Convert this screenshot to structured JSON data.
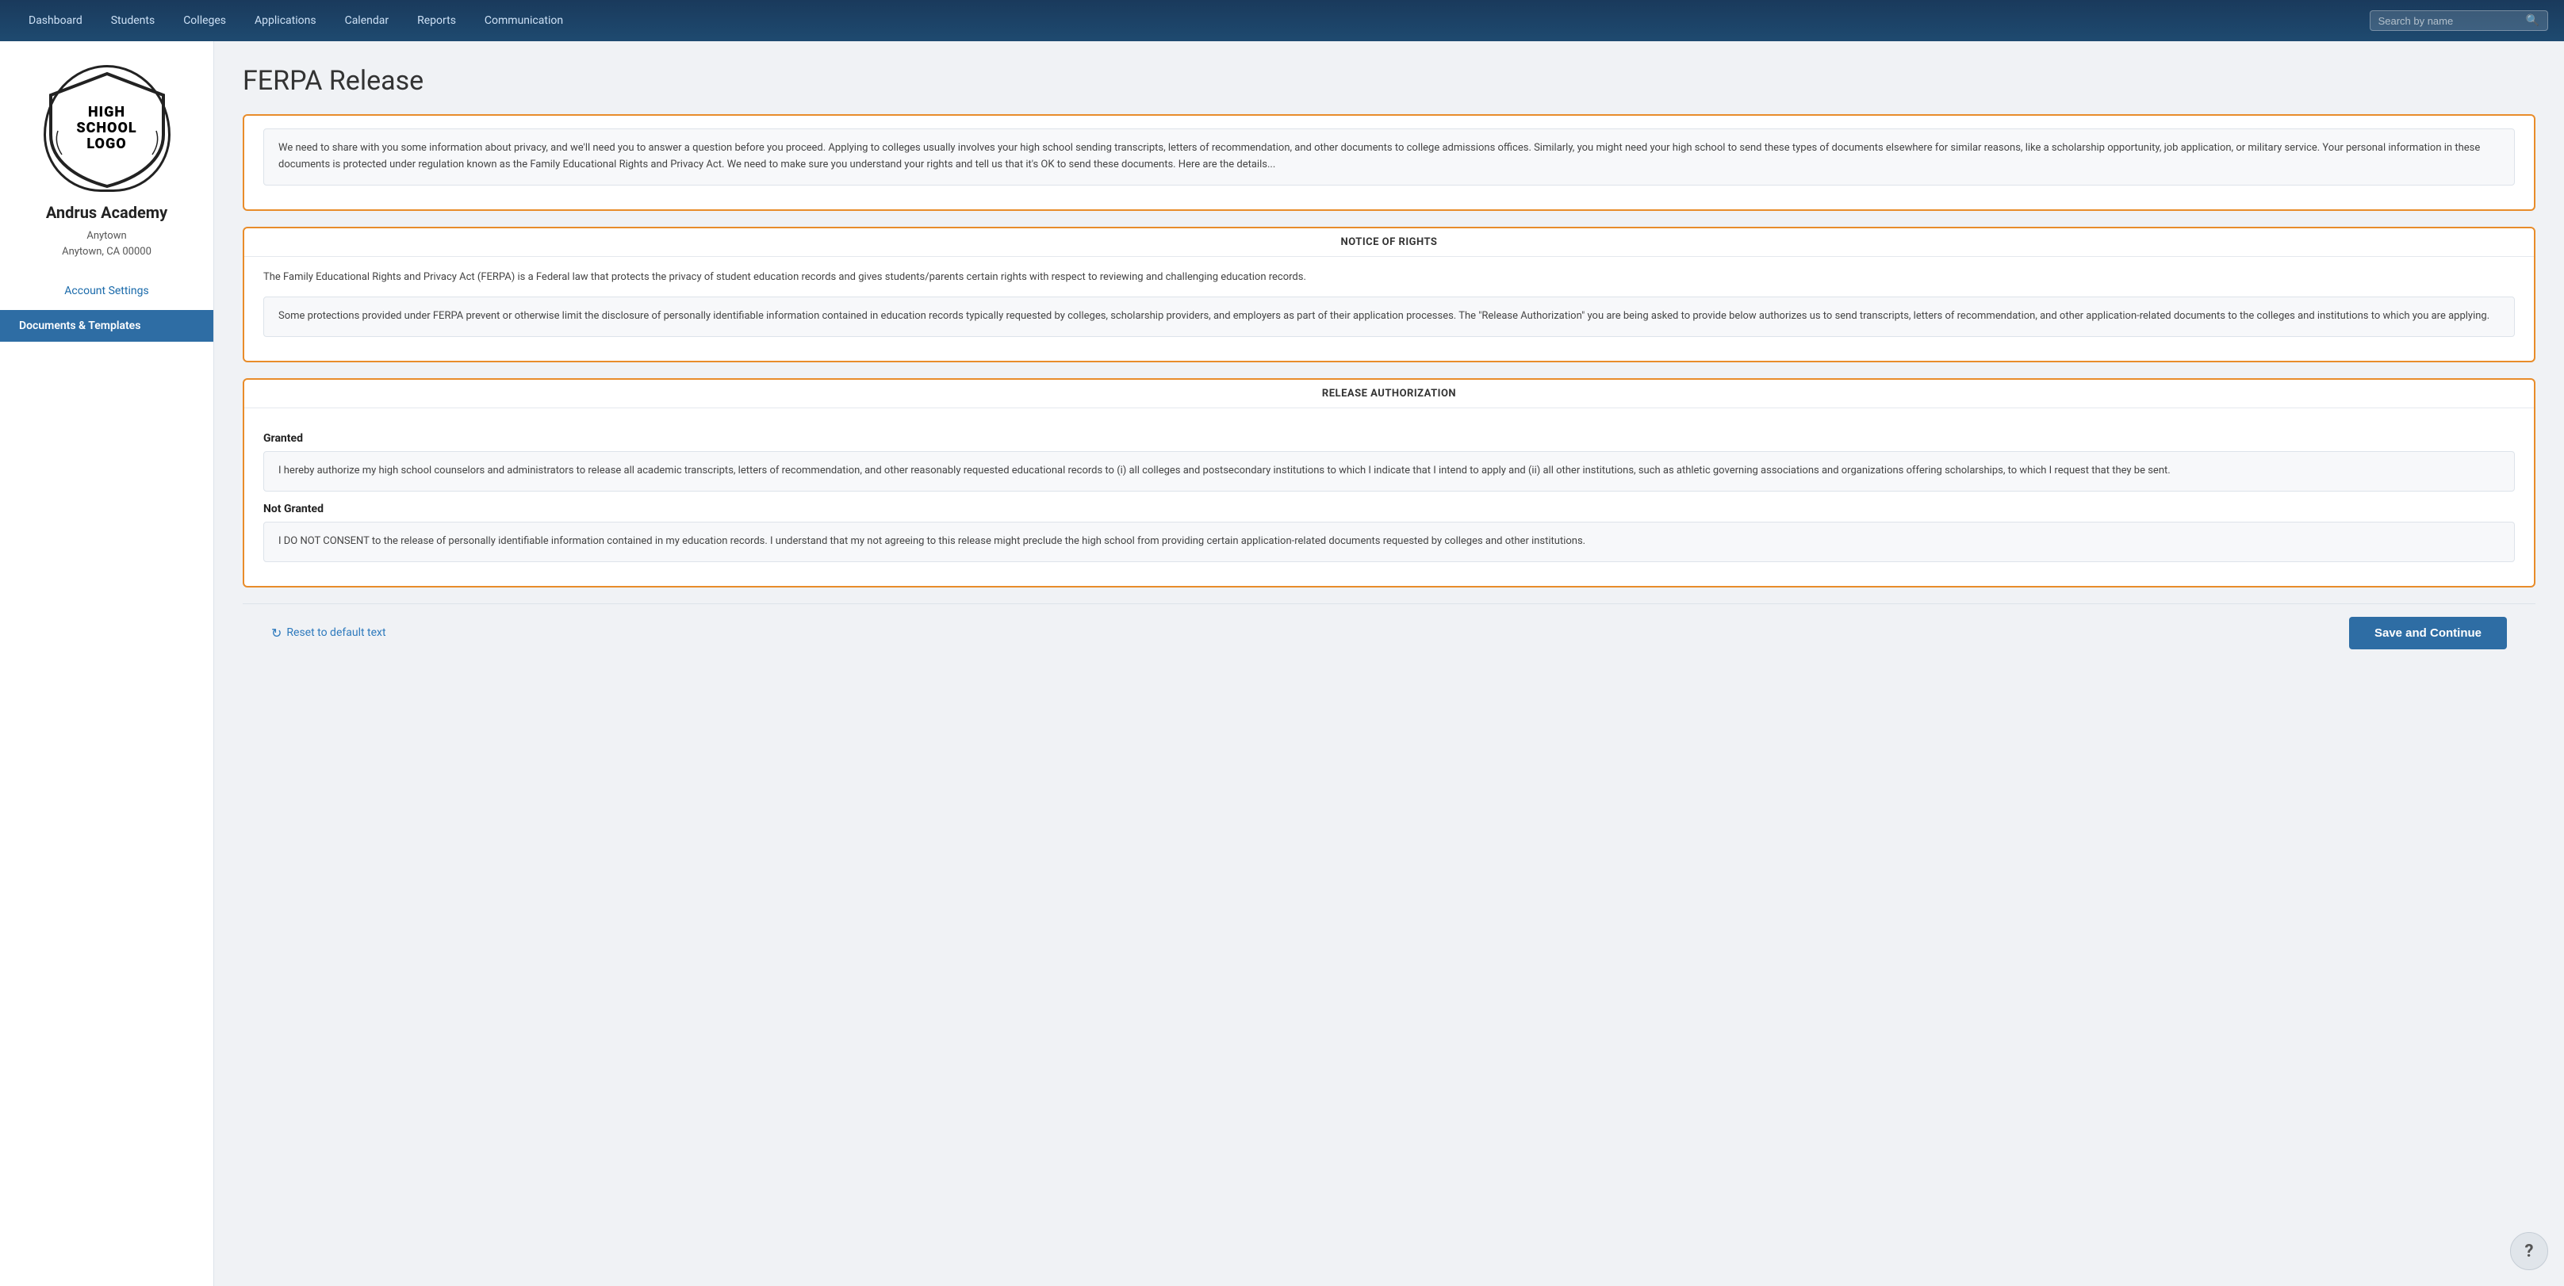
{
  "nav": {
    "items": [
      {
        "label": "Dashboard",
        "id": "dashboard"
      },
      {
        "label": "Students",
        "id": "students"
      },
      {
        "label": "Colleges",
        "id": "colleges"
      },
      {
        "label": "Applications",
        "id": "applications"
      },
      {
        "label": "Calendar",
        "id": "calendar"
      },
      {
        "label": "Reports",
        "id": "reports"
      },
      {
        "label": "Communication",
        "id": "communication"
      }
    ],
    "search_placeholder": "Search by name"
  },
  "sidebar": {
    "school_name": "Andrus Academy",
    "school_address_line1": "Anytown",
    "school_address_line2": "Anytown, CA 00000",
    "logo_line1": "HIGH",
    "logo_line2": "SCHOOL",
    "logo_line3": "LOGO",
    "account_settings_label": "Account Settings",
    "active_item_label": "Documents & Templates"
  },
  "page": {
    "title": "FERPA Release",
    "intro_text": "We need to share with you some information about privacy, and we'll need you to answer a question before you proceed. Applying to colleges usually involves your high school sending transcripts, letters of recommendation, and other documents to college admissions offices. Similarly, you might need your high school to send these types of documents elsewhere for similar reasons, like a scholarship opportunity, job application, or military service. Your personal information in these documents is protected under regulation known as the Family Educational Rights and Privacy Act. We need to make sure you understand your rights and tell us that it's OK to send these documents. Here are the details...",
    "notice_header": "NOTICE OF RIGHTS",
    "notice_text": "The Family Educational Rights and Privacy Act (FERPA) is a Federal law that protects the privacy of student education records and gives students/parents certain rights with respect to reviewing and challenging education records.",
    "notice_block_text": "Some protections provided under FERPA prevent or otherwise limit the disclosure of personally identifiable information contained in education records typically requested by colleges, scholarship providers, and employers as part of their application processes. The \"Release Authorization\" you are being asked to provide below authorizes us to send transcripts, letters of recommendation, and other application-related documents to the colleges and institutions to which you are applying.",
    "release_header": "RELEASE AUTHORIZATION",
    "granted_label": "Granted",
    "granted_text": "I hereby authorize my high school counselors and administrators to release all academic transcripts, letters of recommendation, and other reasonably requested educational records to (i) all colleges and postsecondary institutions to which I indicate that I intend to apply and (ii) all other institutions, such as athletic governing associations and organizations offering scholarships, to which I request that they be sent.",
    "not_granted_label": "Not Granted",
    "not_granted_text": "I DO NOT CONSENT to the release of personally identifiable information contained in my education records. I understand that my not agreeing to this release might preclude the high school from providing certain application-related documents requested by colleges and other institutions.",
    "reset_label": "Reset to default text",
    "save_label": "Save and Continue"
  }
}
